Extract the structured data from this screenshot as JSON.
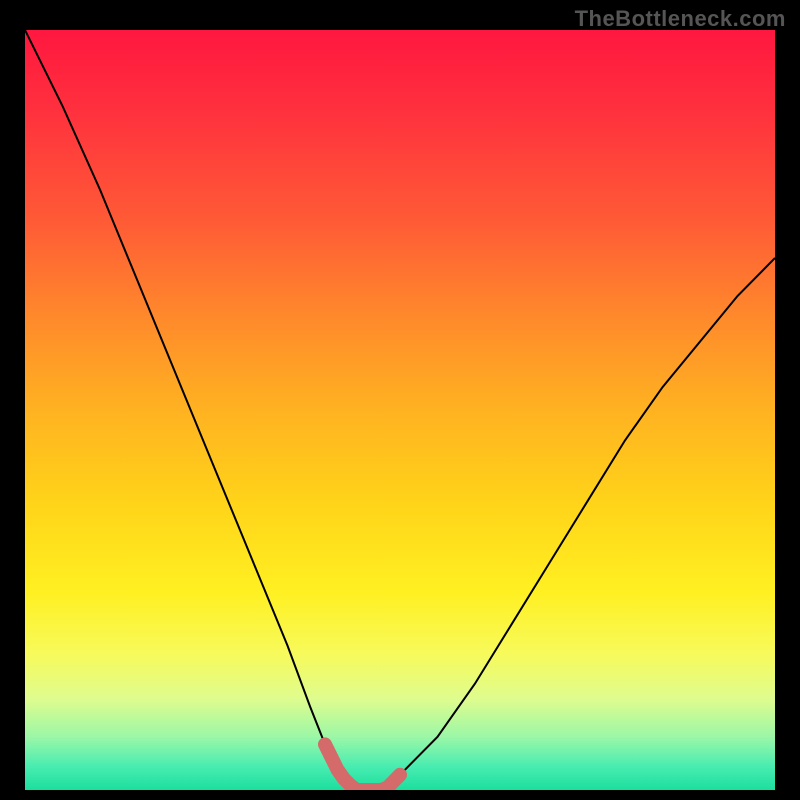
{
  "watermark": "TheBottleneck.com",
  "chart_data": {
    "type": "line",
    "title": "",
    "xlabel": "",
    "ylabel": "",
    "xlim": [
      0,
      100
    ],
    "ylim": [
      0,
      100
    ],
    "series": [
      {
        "name": "bottleneck-curve",
        "x": [
          0,
          5,
          10,
          15,
          20,
          25,
          30,
          35,
          38,
          40,
          42,
          44,
          46,
          48,
          50,
          55,
          60,
          65,
          70,
          75,
          80,
          85,
          90,
          95,
          100
        ],
        "y": [
          100,
          90,
          79,
          67,
          55,
          43,
          31,
          19,
          11,
          6,
          2,
          0,
          0,
          0,
          2,
          7,
          14,
          22,
          30,
          38,
          46,
          53,
          59,
          65,
          70
        ]
      }
    ],
    "highlight": {
      "name": "optimal-range",
      "x_start": 40,
      "x_end": 50,
      "color": "#d46a6a"
    },
    "gradient_stops": [
      {
        "pos": 0.0,
        "color": "#ff173f"
      },
      {
        "pos": 0.5,
        "color": "#ffd319"
      },
      {
        "pos": 0.82,
        "color": "#f7fa5a"
      },
      {
        "pos": 1.0,
        "color": "#1bdf9e"
      }
    ]
  }
}
